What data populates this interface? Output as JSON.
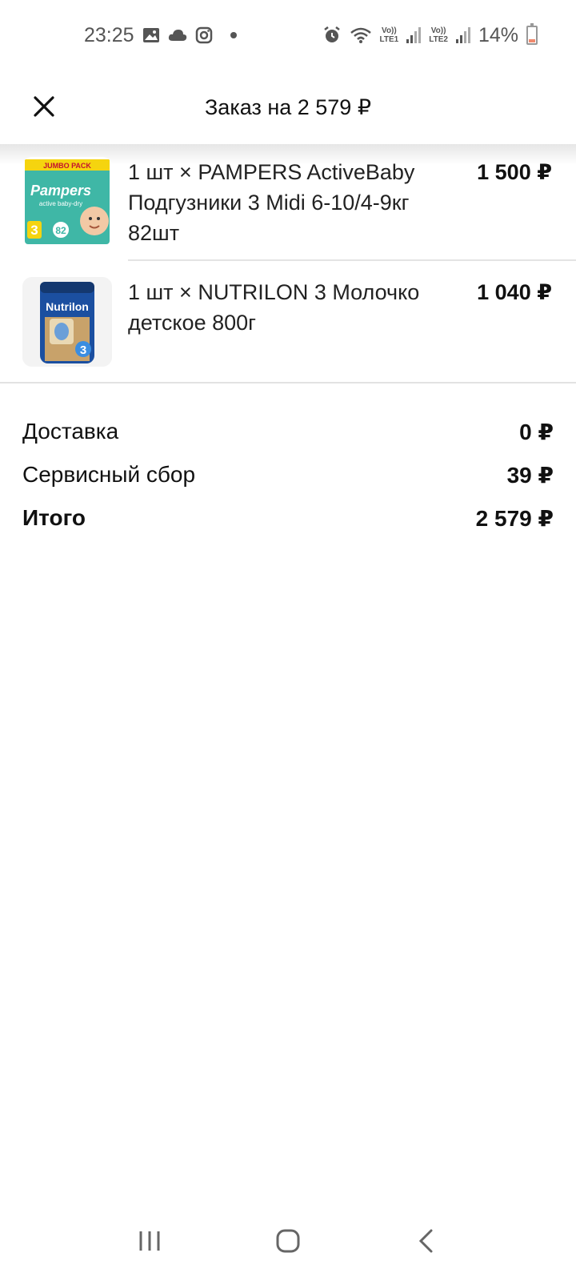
{
  "status_bar": {
    "time": "23:25",
    "battery": "14%",
    "sim1": "LTE1",
    "sim2": "LTE2",
    "volte": "Vo))",
    "icons": [
      "gallery-icon",
      "cloud-icon",
      "instagram-icon",
      "alarm-icon",
      "wifi-icon",
      "signal-icon",
      "battery-icon"
    ]
  },
  "header": {
    "title": "Заказ на 2 579 ₽",
    "close_icon": "close-icon"
  },
  "items": [
    {
      "name": "1 шт × PAMPERS ActiveBaby Подгузники 3 Midi 6-10/4-9кг 82шт",
      "price": "1 500 ₽",
      "image_text": "JUMBO PACK",
      "image_brand": "Pampers",
      "image_sub": "active baby-dry",
      "image_size": "3",
      "image_count": "82"
    },
    {
      "name": "1 шт × NUTRILON 3 Молочко детское 800г",
      "price": "1 040 ₽",
      "image_brand": "Nutrilon",
      "image_size": "3"
    }
  ],
  "summary": {
    "delivery_label": "Доставка",
    "delivery_value": "0 ₽",
    "service_label": "Сервисный сбор",
    "service_value": "39 ₽",
    "total_label": "Итого",
    "total_value": "2 579 ₽"
  },
  "colors": {
    "accent_price": "#111111",
    "pampers_teal": "#3fb7a6",
    "nutrilon_blue": "#1b4fa0"
  }
}
